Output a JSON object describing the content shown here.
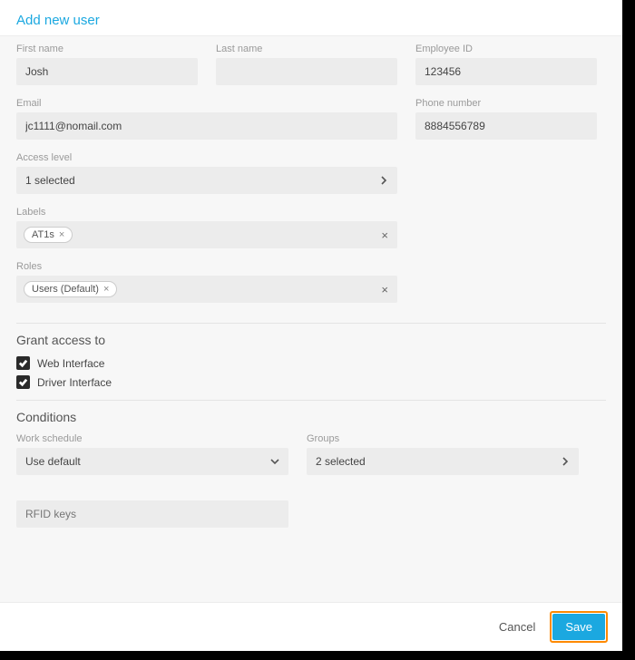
{
  "header": {
    "title": "Add new user"
  },
  "fields": {
    "first_name": {
      "label": "First name",
      "value": "Josh"
    },
    "last_name": {
      "label": "Last name",
      "value": ""
    },
    "employee_id": {
      "label": "Employee ID",
      "value": "123456"
    },
    "email": {
      "label": "Email",
      "value": "jc1111@nomail.com"
    },
    "phone": {
      "label": "Phone number",
      "value": "8884556789"
    },
    "access_level": {
      "label": "Access level",
      "value": "1 selected"
    },
    "labels": {
      "label": "Labels",
      "chips": [
        "AT1s"
      ]
    },
    "roles": {
      "label": "Roles",
      "chips": [
        "Users (Default)"
      ]
    }
  },
  "grant": {
    "title": "Grant access to",
    "items": [
      {
        "label": "Web Interface",
        "checked": true
      },
      {
        "label": "Driver Interface",
        "checked": true
      }
    ]
  },
  "conditions": {
    "title": "Conditions",
    "work_schedule": {
      "label": "Work schedule",
      "value": "Use default"
    },
    "groups": {
      "label": "Groups",
      "value": "2 selected"
    },
    "rfid": {
      "placeholder": "RFID keys"
    }
  },
  "footer": {
    "cancel": "Cancel",
    "save": "Save"
  }
}
